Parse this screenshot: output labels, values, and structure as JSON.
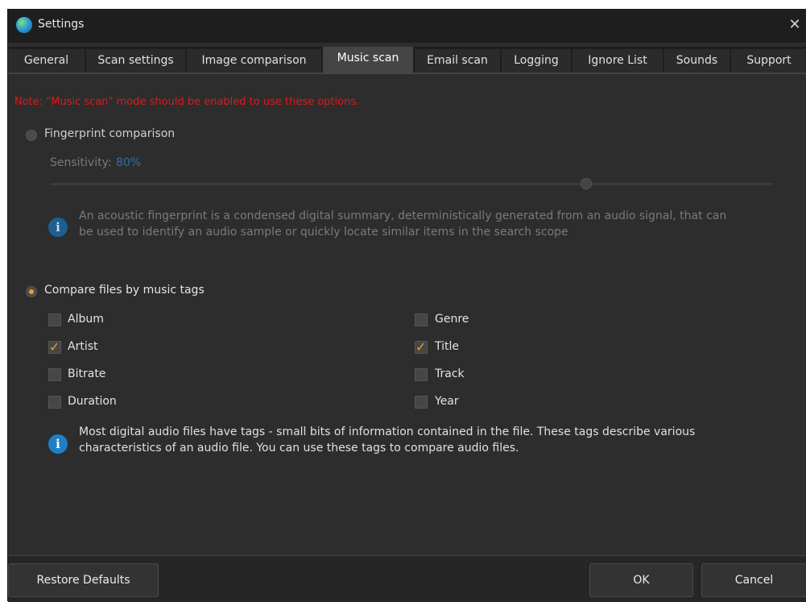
{
  "window": {
    "title": "Settings",
    "close_glyph": "✕"
  },
  "tabs": [
    {
      "label": "General"
    },
    {
      "label": "Scan settings"
    },
    {
      "label": "Image comparison"
    },
    {
      "label": "Music scan",
      "active": true
    },
    {
      "label": "Email scan"
    },
    {
      "label": "Logging"
    },
    {
      "label": "Ignore List"
    },
    {
      "label": "Sounds"
    },
    {
      "label": "Support"
    }
  ],
  "note": "Note: \"Music scan\" mode should be enabled to use these options.",
  "fingerprint": {
    "label": "Fingerprint comparison",
    "selected": false,
    "sensitivity_label": "Sensitivity:",
    "sensitivity_value": "80%",
    "slider_level": 0.8,
    "info_line1": "An acoustic fingerprint is a condensed digital summary, deterministically generated from an audio signal, that can",
    "info_line2": "be used to identify an audio sample or quickly locate similar items in the search scope"
  },
  "tags": {
    "label": "Compare files by music tags",
    "selected": true,
    "left_column": [
      {
        "label": "Album",
        "checked": false
      },
      {
        "label": "Artist",
        "checked": true
      },
      {
        "label": "Bitrate",
        "checked": false
      },
      {
        "label": "Duration",
        "checked": false
      }
    ],
    "right_column": [
      {
        "label": "Genre",
        "checked": false
      },
      {
        "label": "Title",
        "checked": true
      },
      {
        "label": "Track",
        "checked": false
      },
      {
        "label": "Year",
        "checked": false
      }
    ],
    "info_line1": "Most digital audio files have tags - small bits of information contained in the file. These tags describe various",
    "info_line2": "characteristics of an audio file. You can use these tags to compare audio files."
  },
  "footer": {
    "restore_label": "Restore Defaults",
    "ok_label": "OK",
    "cancel_label": "Cancel"
  },
  "colors": {
    "note_red": "#e01818",
    "accent_orange": "#e8a21a",
    "info_blue": "#1e7fc8",
    "sensitivity_blue": "#2f6fa8"
  },
  "icons": {
    "app": "app-globe-icon",
    "info": "info-icon",
    "close": "close-icon"
  }
}
